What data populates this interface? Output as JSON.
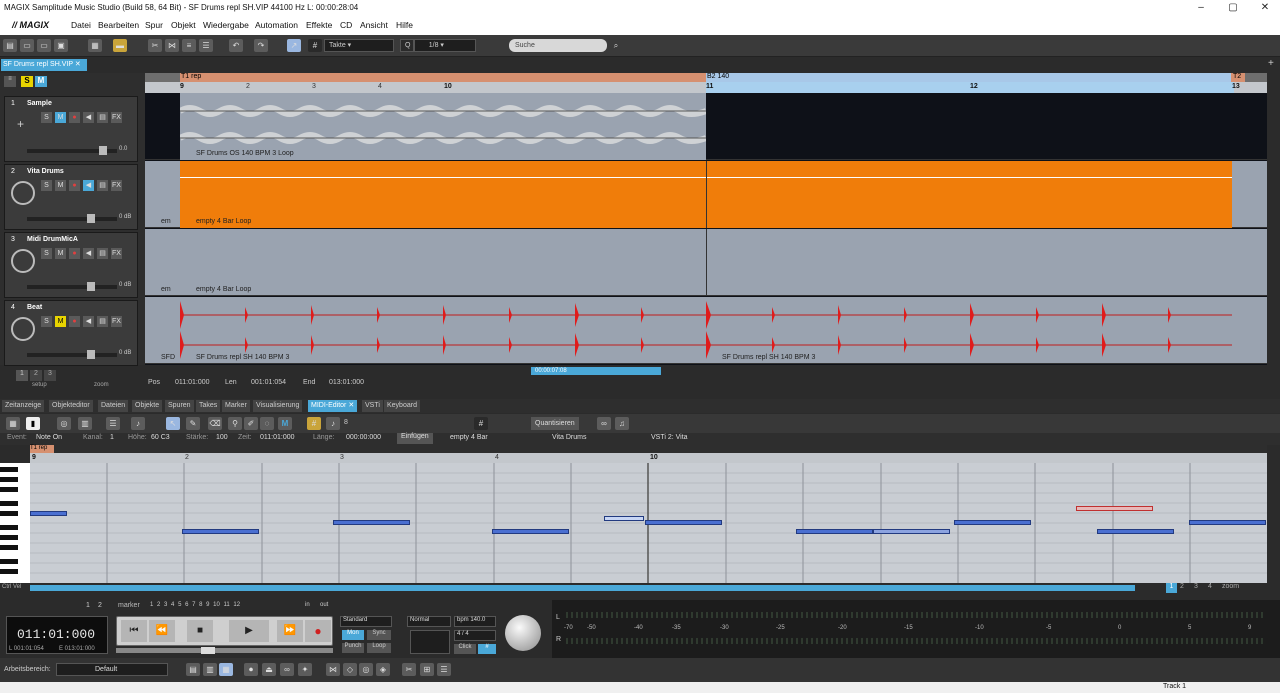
{
  "window": {
    "title": "MAGIX Samplitude Music Studio (Build 58, 64 Bit)  -  SF Drums repl SH.VIP   44100 Hz L: 00:00:28:04"
  },
  "menu": {
    "logo": "// MAGIX",
    "items": [
      "Datei",
      "Bearbeiten",
      "Spur",
      "Objekt",
      "Wiedergabe",
      "Automation",
      "Effekte",
      "CD",
      "Ansicht",
      "Hilfe"
    ]
  },
  "toolbar": {
    "grid_mode": "Takte",
    "quantize": "Q",
    "quantize_value": "1/8",
    "search_placeholder": "Suche"
  },
  "project_tab": "SF Drums repl SH.VIP",
  "ruler": {
    "marker_start": "T1 rep",
    "marker_b2": "B2 140",
    "marker_end": "T2",
    "bars": [
      "9",
      "10",
      "11",
      "12",
      "13"
    ],
    "beats": [
      "2",
      "3",
      "4"
    ]
  },
  "tracks": [
    {
      "num": "1",
      "name": "Sample",
      "vol": "0.0"
    },
    {
      "num": "2",
      "name": "Vita Drums",
      "vol": "0 dB"
    },
    {
      "num": "3",
      "name": "Midi DrumMicA",
      "vol": "0 dB"
    },
    {
      "num": "4",
      "name": "Beat",
      "vol": "0 dB"
    }
  ],
  "clips": {
    "sample": "SF Drums OS 140 BPM 3  Loop",
    "vita": "empty 4 Bar   Loop",
    "midi": "empty 4 Bar   Loop",
    "beat1": "SF Drums repl SH 140 BPM 3",
    "beat2": "SF Drums repl SH 140 BPM 3",
    "em": "em",
    "sfd": "SFD"
  },
  "track_buttons": {
    "s": "S",
    "m": "M",
    "fx": "FX"
  },
  "arranger_footer": {
    "setup": "setup",
    "zoom": "zoom",
    "pages": [
      "1",
      "2",
      "3",
      "4"
    ],
    "pos_label": "Pos",
    "pos": "011:01:000",
    "len_label": "Len",
    "len": "001:01:054",
    "end_label": "End",
    "end": "013:01:000",
    "timebar": "00:00:07:08"
  },
  "dock_tabs": [
    "Zeitanzeige",
    "Objekteditor",
    "Dateien",
    "Objekte",
    "Spuren",
    "Takes",
    "Marker",
    "Visualisierung",
    "MIDI-Editor",
    "VSTi",
    "Keyboard"
  ],
  "midi_toolbar": {
    "quantize_btn": "Quantisieren",
    "value": "8",
    "hash": "#"
  },
  "midi_info": {
    "event": "Event:",
    "event_val": "Note On",
    "kanal": "Kanal:",
    "kanal_val": "1",
    "hoehe": "Höhe:",
    "hoehe_val": "60 C3",
    "staerke": "Stärke:",
    "staerke_val": "100",
    "zeit": "Zeit:",
    "zeit_val": "011:01:000",
    "laenge": "Länge:",
    "laenge_val": "000:00:000",
    "insert": "Einfügen",
    "object": "empty 4 Bar",
    "track": "Vita Drums",
    "vsti": "VSTi 2: Vita"
  },
  "piano_ruler": {
    "marker": "T1 rep",
    "bars": [
      "9",
      "10"
    ],
    "beats": [
      "2",
      "3",
      "4"
    ]
  },
  "midi_footer": {
    "zoom": "zoom",
    "pages": [
      "1",
      "2",
      "3",
      "4"
    ],
    "left": "Ctrl Vel"
  },
  "transport": {
    "time": "011:01:000",
    "L": "L 001:01:054",
    "E": "E 013:01:000",
    "marker_label": "marker",
    "marker_nums": [
      "1",
      "2",
      "3",
      "4",
      "5",
      "6",
      "7",
      "8",
      "9",
      "10",
      "11",
      "12"
    ],
    "top_nums": [
      "1",
      "2"
    ],
    "in": "in",
    "out": "out",
    "mode": "Standard",
    "mon": "Mon",
    "sync": "Sync",
    "punch": "Punch",
    "loop": "Loop",
    "normal": "Normal",
    "bpm": "bpm 140.0",
    "sig": "4 / 4",
    "click": "Click"
  },
  "meter": {
    "scale": [
      "-70",
      "-50",
      "-40",
      "-35",
      "-30",
      "-25",
      "-20",
      "-15",
      "-10",
      "-5",
      "0",
      "5",
      "9"
    ],
    "L": "L",
    "R": "R"
  },
  "footer": {
    "workspace_label": "Arbeitsbereich:",
    "workspace": "Default"
  },
  "status": {
    "right": "Track 1"
  },
  "colors": {
    "accent": "#4aa8d8",
    "orange": "#f07d0a",
    "wave_red": "#e01c1c",
    "midi_note": "#4a6fd1"
  }
}
